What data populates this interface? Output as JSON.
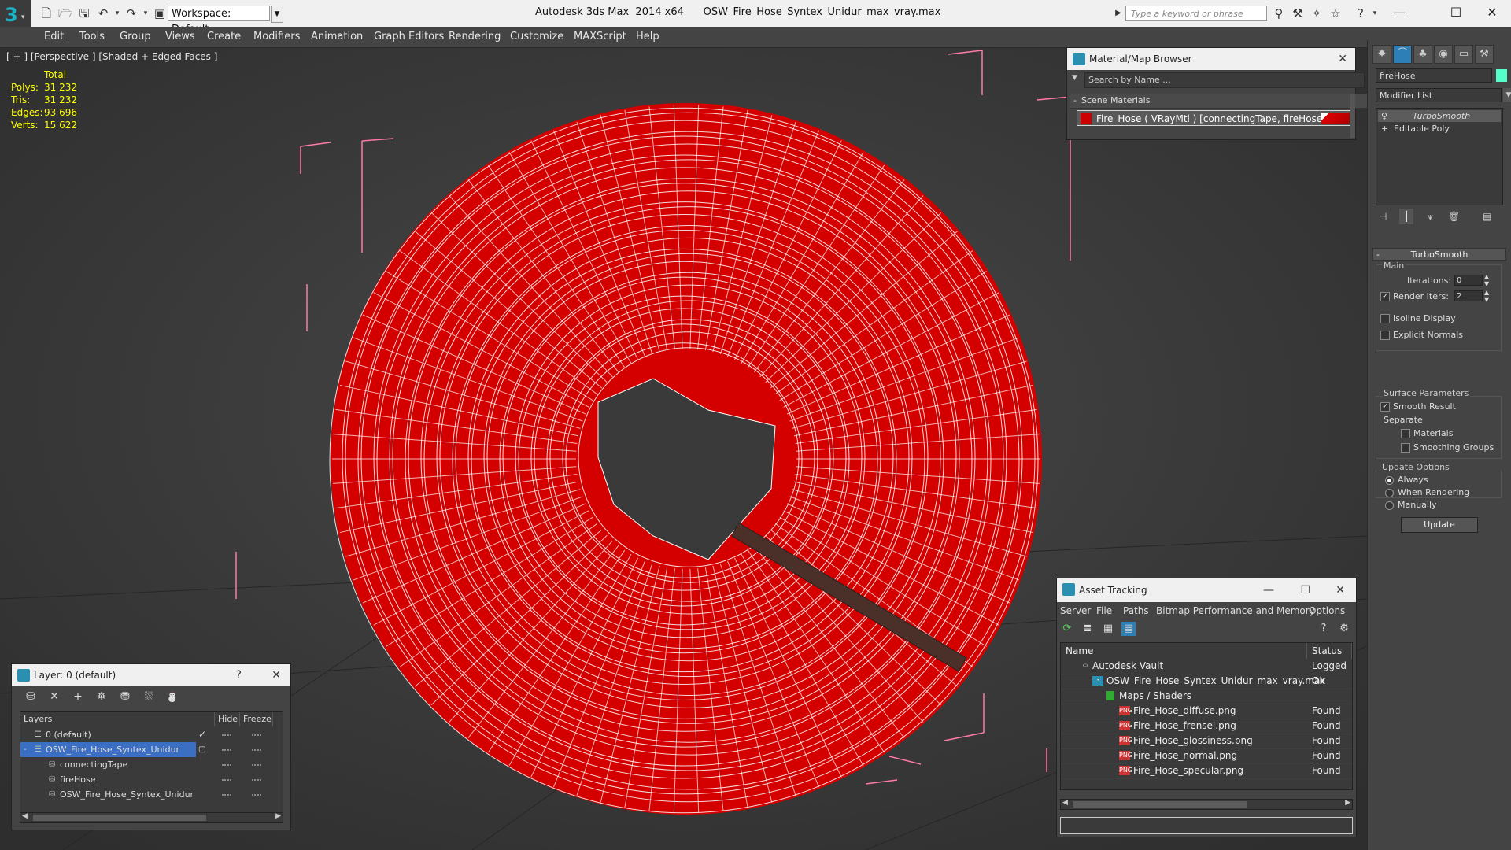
{
  "titlebar": {
    "workspace": "Workspace: Default",
    "title": "Autodesk 3ds Max  2014 x64      OSW_Fire_Hose_Syntex_Unidur_max_vray.max",
    "search_placeholder": "Type a keyword or phrase"
  },
  "menu": [
    "Edit",
    "Tools",
    "Group",
    "Views",
    "Create",
    "Modifiers",
    "Animation",
    "Graph Editors",
    "Rendering",
    "Customize",
    "MAXScript",
    "Help"
  ],
  "viewport": {
    "label": "[ + ] [Perspective ] [Shaded + Edged Faces ]",
    "stats": {
      "header": "Total",
      "rows": [
        {
          "label": "Polys:",
          "value": "31 232"
        },
        {
          "label": "Tris:",
          "value": "31 232"
        },
        {
          "label": "Edges:",
          "value": "93 696"
        },
        {
          "label": "Verts:",
          "value": "15 622"
        }
      ]
    },
    "mesh_color": "#e00000",
    "wire_color": "#ffffff",
    "bbox_color": "#ff7aa8"
  },
  "material_browser": {
    "title": "Material/Map Browser",
    "search_placeholder": "Search by Name ...",
    "section": "Scene Materials",
    "entry": "Fire_Hose  ( VRayMtl )  [connectingTape, fireHose]"
  },
  "command_panel": {
    "object_name": "fireHose",
    "modifier_list": "Modifier List",
    "stack": [
      "TurboSmooth",
      "Editable Poly"
    ],
    "turbosmooth": {
      "title": "TurboSmooth",
      "main": "Main",
      "iterations_label": "Iterations:",
      "iterations": "0",
      "render_iters_label": "Render Iters:",
      "render_iters": "2",
      "render_iters_checked": true,
      "isoline": "Isoline Display",
      "explicit_normals": "Explicit Normals",
      "surface_params": "Surface Parameters",
      "smooth_result": "Smooth Result",
      "separate": "Separate",
      "materials": "Materials",
      "smoothing_groups": "Smoothing Groups",
      "update_options": "Update Options",
      "always": "Always",
      "when_rendering": "When Rendering",
      "manually": "Manually",
      "update_button": "Update"
    }
  },
  "layers": {
    "title": "Layer: 0 (default)",
    "help": "?",
    "columns": {
      "layers": "Layers",
      "hide": "Hide",
      "freeze": "Freeze"
    },
    "rows": [
      {
        "name": "0 (default)"
      },
      {
        "name": "OSW_Fire_Hose_Syntex_Unidur"
      },
      {
        "name": "connectingTape"
      },
      {
        "name": "fireHose"
      },
      {
        "name": "OSW_Fire_Hose_Syntex_Unidur"
      }
    ]
  },
  "asset_tracking": {
    "title": "Asset Tracking",
    "menu": [
      "Server",
      "File",
      "Paths",
      "Bitmap Performance and Memory",
      "Options"
    ],
    "columns": {
      "name": "Name",
      "status": "Status"
    },
    "rows": [
      {
        "name": "Autodesk Vault",
        "status": "Logged O"
      },
      {
        "name": "OSW_Fire_Hose_Syntex_Unidur_max_vray.max",
        "status": "Ok"
      },
      {
        "name": "Maps / Shaders",
        "status": ""
      },
      {
        "name": "Fire_Hose_diffuse.png",
        "status": "Found"
      },
      {
        "name": "Fire_Hose_frensel.png",
        "status": "Found"
      },
      {
        "name": "Fire_Hose_glossiness.png",
        "status": "Found"
      },
      {
        "name": "Fire_Hose_normal.png",
        "status": "Found"
      },
      {
        "name": "Fire_Hose_specular.png",
        "status": "Found"
      }
    ]
  }
}
